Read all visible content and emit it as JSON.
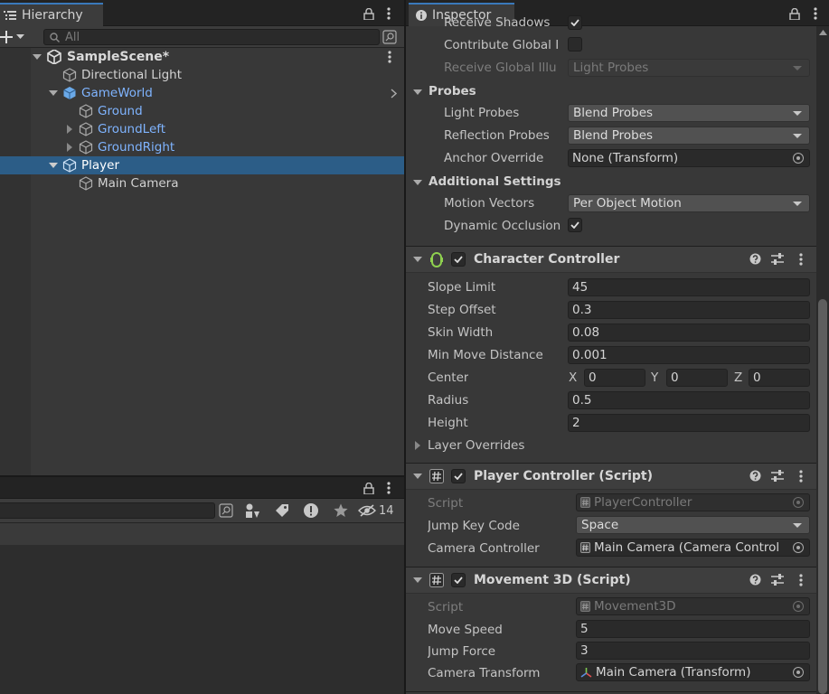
{
  "hierarchy": {
    "tab_title": "Hierarchy",
    "search_placeholder": "All",
    "scene_name": "SampleScene*",
    "items": [
      {
        "label": "Directional Light"
      },
      {
        "label": "GameWorld"
      },
      {
        "label": "Ground"
      },
      {
        "label": "GroundLeft"
      },
      {
        "label": "GroundRight"
      },
      {
        "label": "Player"
      },
      {
        "label": "Main Camera"
      }
    ]
  },
  "bottom_panel": {
    "hidden_count": "14"
  },
  "inspector": {
    "tab_title": "Inspector",
    "mesh_renderer": {
      "receive_shadows_label": "Receive Shadows",
      "contribute_gi_label": "Contribute Global I",
      "receive_gi_label": "Receive Global Illu",
      "receive_gi_value": "Light Probes",
      "probes_section": "Probes",
      "light_probes_label": "Light Probes",
      "light_probes_value": "Blend Probes",
      "reflection_probes_label": "Reflection Probes",
      "reflection_probes_value": "Blend Probes",
      "anchor_override_label": "Anchor Override",
      "anchor_override_value": "None (Transform)",
      "additional_section": "Additional Settings",
      "motion_vectors_label": "Motion Vectors",
      "motion_vectors_value": "Per Object Motion",
      "dynamic_occlusion_label": "Dynamic Occlusion"
    },
    "character_controller": {
      "title": "Character Controller",
      "slope_limit_label": "Slope Limit",
      "slope_limit_value": "45",
      "step_offset_label": "Step Offset",
      "step_offset_value": "0.3",
      "skin_width_label": "Skin Width",
      "skin_width_value": "0.08",
      "min_move_label": "Min Move Distance",
      "min_move_value": "0.001",
      "center_label": "Center",
      "center_x_label": "X",
      "center_x": "0",
      "center_y_label": "Y",
      "center_y": "0",
      "center_z_label": "Z",
      "center_z": "0",
      "radius_label": "Radius",
      "radius_value": "0.5",
      "height_label": "Height",
      "height_value": "2",
      "layer_overrides_label": "Layer Overrides"
    },
    "player_controller": {
      "title": "Player Controller (Script)",
      "script_label": "Script",
      "script_value": "PlayerController",
      "jump_key_label": "Jump Key Code",
      "jump_key_value": "Space",
      "camera_controller_label": "Camera Controller",
      "camera_controller_value": "Main Camera (Camera Control"
    },
    "movement3d": {
      "title": "Movement 3D (Script)",
      "script_label": "Script",
      "script_value": "Movement3D",
      "move_speed_label": "Move Speed",
      "move_speed_value": "5",
      "jump_force_label": "Jump Force",
      "jump_force_value": "3",
      "camera_transform_label": "Camera Transform",
      "camera_transform_value": "Main Camera (Transform)"
    }
  },
  "colors": {
    "accent": "#3a79bb",
    "selection": "#2c5d87",
    "link_blue": "#7fb4ff",
    "panel": "#383838",
    "field": "#2a2a2a"
  }
}
